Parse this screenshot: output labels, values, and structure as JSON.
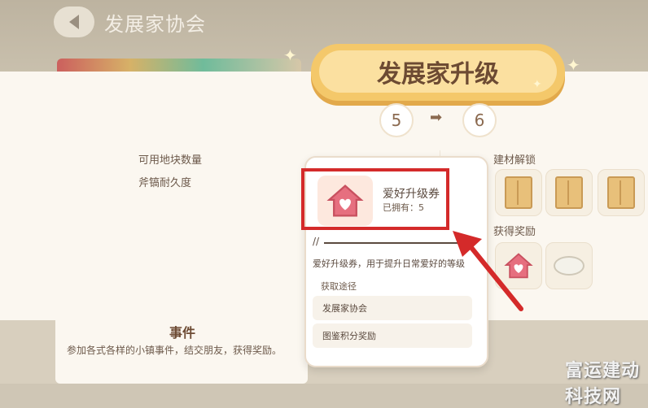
{
  "header": {
    "title": "发展家协会"
  },
  "banner": {
    "title": "发展家升级"
  },
  "level": {
    "from": "5",
    "to": "6",
    "arrow": "➡"
  },
  "stats": [
    {
      "label": "可用地块数量"
    },
    {
      "label": "斧镐耐久度"
    }
  ],
  "right": {
    "unlock_label": "建材解锁",
    "reward_label": "获得奖励"
  },
  "popup": {
    "item_name": "爱好升级券",
    "owned": "已拥有：5",
    "description": "爱好升级券，用于提升日常爱好的等级",
    "source_title": "获取途径",
    "sources": [
      "发展家协会",
      "图鉴积分奖励"
    ]
  },
  "event": {
    "title": "事件",
    "description": "参加各式各样的小镇事件，结交朋友，获得奖励。"
  },
  "watermark": {
    "text": "富运建动科技网"
  },
  "colors": {
    "highlight": "#d42a2a",
    "banner": "#f4c86a",
    "text": "#6d5a4b"
  }
}
